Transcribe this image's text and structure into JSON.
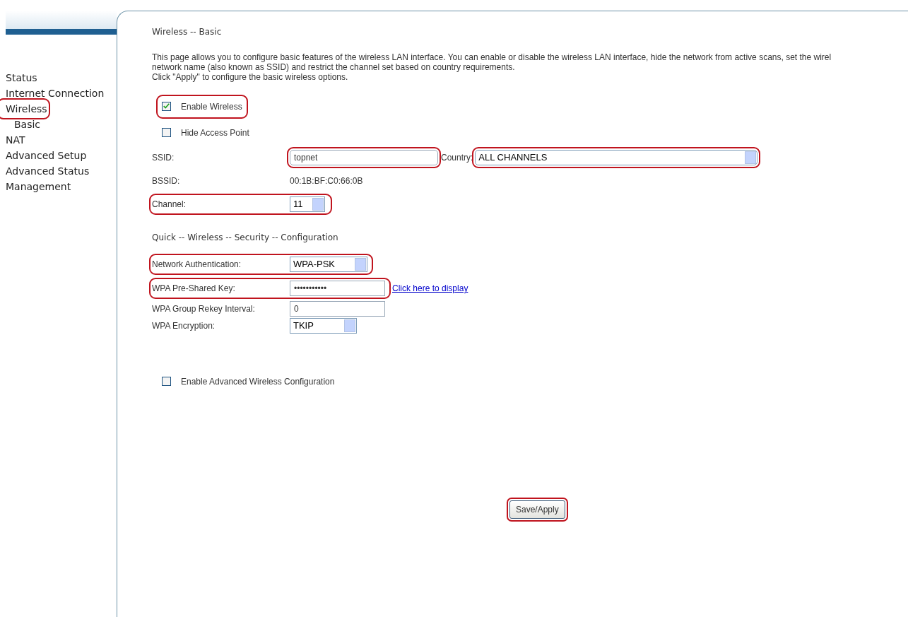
{
  "sidebar": {
    "items": [
      {
        "label": "Status",
        "highlighted": false
      },
      {
        "label": "Internet Connection",
        "highlighted": false
      },
      {
        "label": "Wireless",
        "highlighted": true,
        "children": [
          {
            "label": "Basic",
            "highlighted": false
          }
        ]
      },
      {
        "label": "NAT",
        "highlighted": false
      },
      {
        "label": "Advanced Setup",
        "highlighted": false
      },
      {
        "label": "Advanced Status",
        "highlighted": false
      },
      {
        "label": "Management",
        "highlighted": false
      }
    ]
  },
  "page": {
    "title": "Wireless -- Basic",
    "description_lines": [
      "This page allows you to configure basic features of the wireless LAN interface. You can enable or disable the wireless LAN interface, hide the network from active scans, set the wirel",
      "network name (also known as SSID) and restrict the channel set based on country requirements.",
      "Click \"Apply\" to configure the basic wireless options."
    ],
    "checkboxes": [
      {
        "label": "Enable Wireless",
        "checked": true,
        "highlighted": true
      },
      {
        "label": "Hide Access Point",
        "checked": false,
        "highlighted": false
      }
    ],
    "ssid": {
      "label": "SSID:",
      "value": "topnet",
      "highlighted": true
    },
    "country": {
      "label": "Country:",
      "value": "ALL CHANNELS",
      "highlighted": true
    },
    "bssid": {
      "label": "BSSID:",
      "value": "00:1B:BF:C0:66:0B"
    },
    "channel": {
      "label": "Channel:",
      "value": "11",
      "highlighted": true
    },
    "security_title": "Quick -- Wireless -- Security -- Configuration",
    "security_fields": [
      {
        "kind": "select",
        "label": "Network Authentication:",
        "value": "WPA-PSK",
        "highlighted": true
      },
      {
        "kind": "text",
        "label": "WPA Pre-Shared Key:",
        "value": "•••••••••••",
        "link": "Click here to display",
        "highlighted": true
      },
      {
        "kind": "text",
        "label": "WPA Group Rekey Interval:",
        "value": "0",
        "highlighted": false
      },
      {
        "kind": "select",
        "label": "WPA Encryption:",
        "value": "TKIP",
        "highlighted": false
      }
    ],
    "advanced_checkbox": {
      "label": "Enable Advanced Wireless Configuration",
      "checked": false
    },
    "save_button": {
      "label": "Save/Apply",
      "highlighted": true
    }
  }
}
